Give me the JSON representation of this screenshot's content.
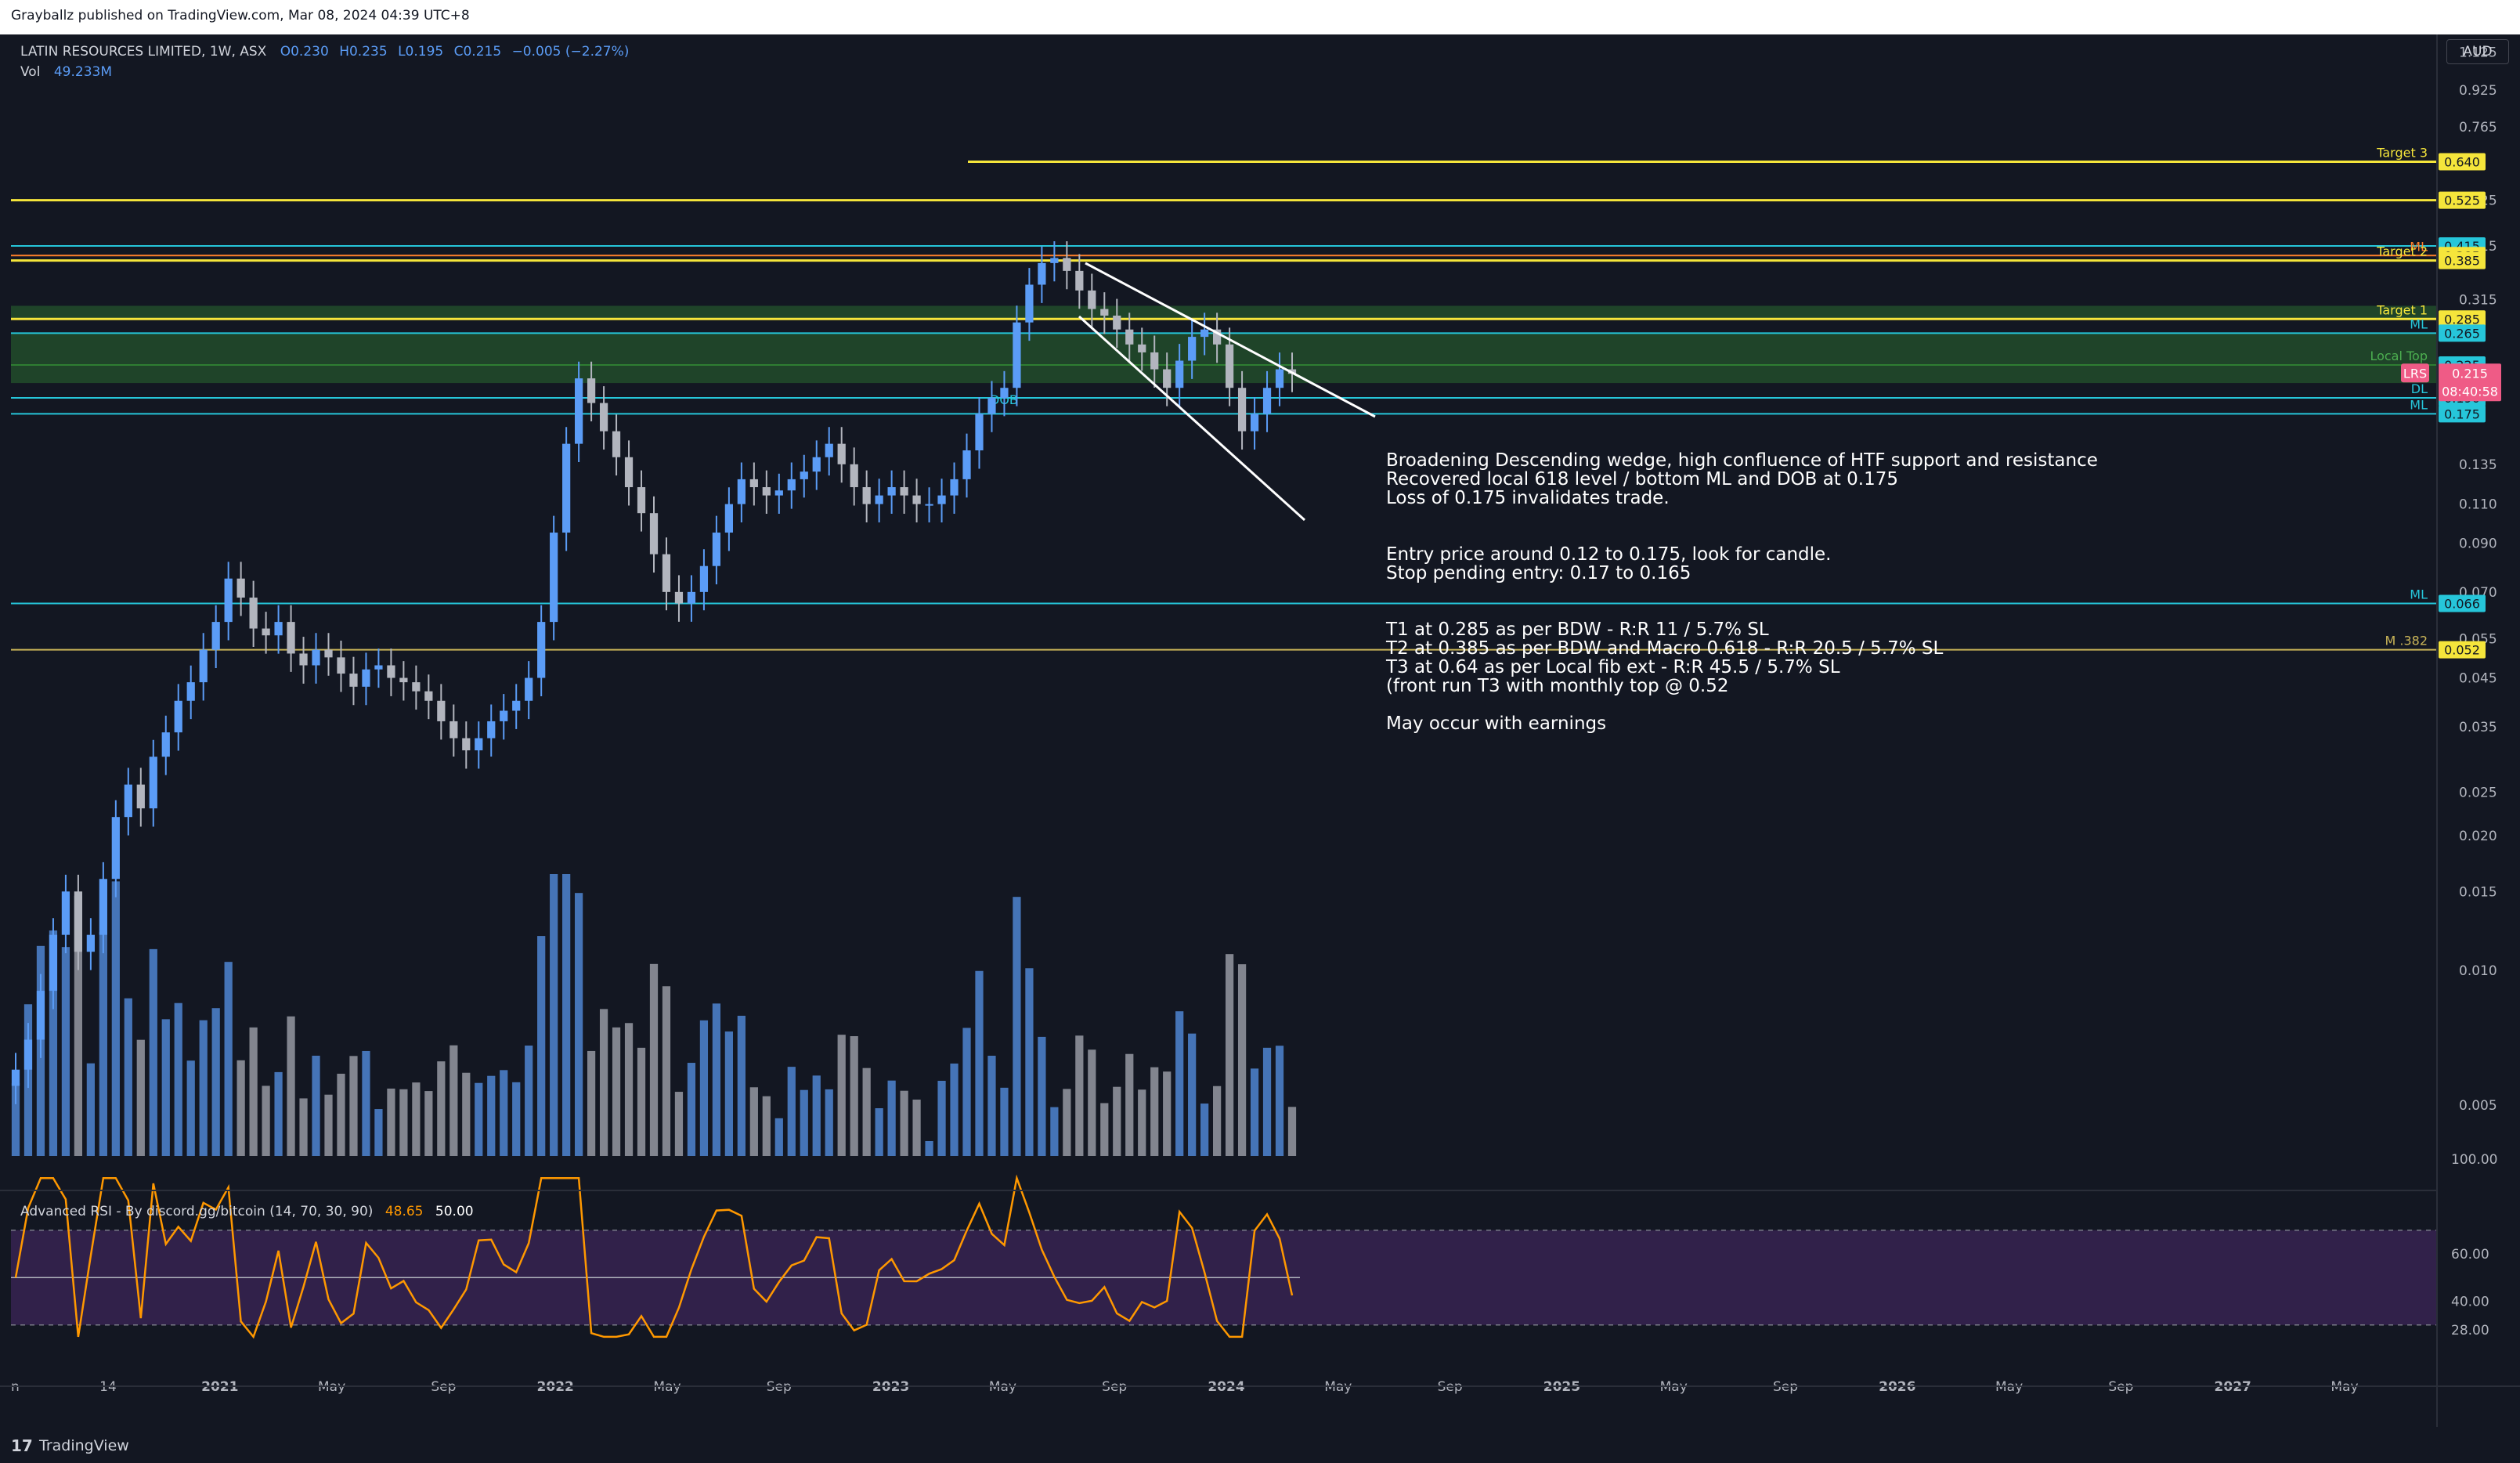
{
  "header": {
    "published_text": "Grayballz published on TradingView.com, Mar 08, 2024 04:39 UTC+8"
  },
  "legend": {
    "symbol": "LATIN RESOURCES LIMITED, 1W, ASX",
    "o": "O0.230",
    "h": "H0.235",
    "l": "L0.195",
    "c": "C0.215",
    "change": "−0.005 (−2.27%)",
    "vol_label": "Vol",
    "vol_value": "49.233M",
    "rsi_label": "Advanced RSI - By discord.gg/bitcoin (14, 70, 30, 90)",
    "rsi_value": "48.65",
    "rsi_mid": "50.00"
  },
  "currency": "AUD",
  "footer": {
    "logo_text": "TradingView"
  },
  "note_lines": [
    "Broadening Descending wedge, high confluence of HTF support and resistance",
    "Recovered local 618 level / bottom ML and DOB at 0.175",
    "Loss of 0.175 invalidates trade.",
    "",
    "",
    "Entry price around 0.12 to 0.175, look for candle.",
    "Stop pending entry: 0.17 to 0.165",
    "",
    "",
    "T1 at 0.285 as per BDW - R:R 11 / 5.7% SL",
    "T2 at 0.385 as per BDW and Macro 0.618 - R:R 20.5 / 5.7% SL",
    "T3 at 0.64 as per Local fib ext - R:R 45.5 / 5.7% SL",
    "(front run T3 with monthly top @ 0.52",
    "",
    "May occur with earnings"
  ],
  "colors": {
    "background": "#131722",
    "bull": "#5b9cf6",
    "bear": "#b2b5be",
    "yellow": "#f5e53b",
    "teal": "#00bcd4",
    "green_zone": "#2e7d32",
    "rsi_line": "#ff9800",
    "rsi_band": "#4a2a6b",
    "price_tag": "#ef5b86",
    "orange": "#ff7f2a"
  },
  "chart_data": {
    "type": "candlestick",
    "scale": "log",
    "ylim": [
      0.004,
      1.3
    ],
    "y_ticks": [
      "1.125",
      "0.925",
      "0.765",
      "0.525",
      "0.415",
      "0.315",
      "0.135",
      "0.110",
      "0.090",
      "0.070",
      "0.055",
      "0.045",
      "0.035",
      "0.025",
      "0.020",
      "0.015",
      "0.010",
      "0.005"
    ],
    "x_ticks": [
      "14",
      "2021",
      "May",
      "Sep",
      "2022",
      "May",
      "Sep",
      "2023",
      "May",
      "Sep",
      "2024",
      "May",
      "Sep",
      "2025",
      "May",
      "Sep",
      "2026",
      "May",
      "Sep",
      "2027",
      "May"
    ],
    "x_first_label": "n",
    "current_price": "0.215",
    "current_symbol": "LRS",
    "countdown": "08:40:58",
    "levels": [
      {
        "price": 0.64,
        "label": "Target 3",
        "price_label": "0.640",
        "color": "#f5e53b",
        "from": "2023-04"
      },
      {
        "price": 0.525,
        "label": "",
        "price_label": "0.525",
        "color": "#f5e53b"
      },
      {
        "price": 0.415,
        "label": "",
        "price_label": "0.415",
        "color": "#26c6da"
      },
      {
        "price": 0.395,
        "label": "ML",
        "price_label": "0.385",
        "color": "#ff7f2a"
      },
      {
        "price": 0.385,
        "label": "Target 2",
        "price_label": "0.385",
        "color": "#f5e53b"
      },
      {
        "price": 0.285,
        "label": "Target 1",
        "price_label": "0.285",
        "color": "#f5e53b"
      },
      {
        "price": 0.265,
        "label": "ML",
        "price_label": "0.265",
        "color": "#26c6da"
      },
      {
        "price": 0.225,
        "label": "Local Top",
        "price_label": "0.225",
        "color": "#2e7d32"
      },
      {
        "price": 0.19,
        "label": "DL",
        "price_label": "0.190",
        "color": "#26c6da"
      },
      {
        "price": 0.175,
        "label": "ML",
        "price_label": "0.175",
        "color": "#26c6da"
      },
      {
        "price": 0.066,
        "label": "ML",
        "price_label": "0.066",
        "color": "#26c6da"
      },
      {
        "price": 0.052,
        "label": "M .382",
        "price_label": "0.052",
        "color": "#c9b458"
      }
    ],
    "zones": [
      {
        "from": 0.285,
        "to": 0.305,
        "color": "#2e7d32"
      },
      {
        "from": 0.205,
        "to": 0.265,
        "color": "#2e7d32"
      }
    ],
    "annotation_dob": "DOB",
    "rsi_ticks": [
      "100.00",
      "60.00",
      "40.00",
      "28.00"
    ],
    "rsi_levels": {
      "upper": 70,
      "mid": 50,
      "lower": 30
    },
    "candles_weekly_close": [
      0.006,
      0.007,
      0.009,
      0.012,
      0.015,
      0.011,
      0.012,
      0.016,
      0.022,
      0.026,
      0.023,
      0.03,
      0.034,
      0.04,
      0.044,
      0.052,
      0.06,
      0.075,
      0.068,
      0.058,
      0.056,
      0.06,
      0.051,
      0.048,
      0.052,
      0.05,
      0.046,
      0.043,
      0.047,
      0.048,
      0.045,
      0.044,
      0.042,
      0.04,
      0.036,
      0.033,
      0.031,
      0.033,
      0.036,
      0.038,
      0.04,
      0.045,
      0.06,
      0.095,
      0.15,
      0.21,
      0.185,
      0.16,
      0.14,
      0.12,
      0.105,
      0.085,
      0.07,
      0.066,
      0.07,
      0.08,
      0.095,
      0.11,
      0.125,
      0.12,
      0.115,
      0.118,
      0.125,
      0.13,
      0.14,
      0.15,
      0.135,
      0.12,
      0.11,
      0.115,
      0.12,
      0.115,
      0.11,
      0.11,
      0.115,
      0.125,
      0.145,
      0.175,
      0.19,
      0.2,
      0.28,
      0.34,
      0.38,
      0.39,
      0.365,
      0.33,
      0.3,
      0.29,
      0.27,
      0.25,
      0.24,
      0.22,
      0.2,
      0.23,
      0.26,
      0.27,
      0.25,
      0.2,
      0.16,
      0.175,
      0.2,
      0.22,
      0.215
    ]
  }
}
